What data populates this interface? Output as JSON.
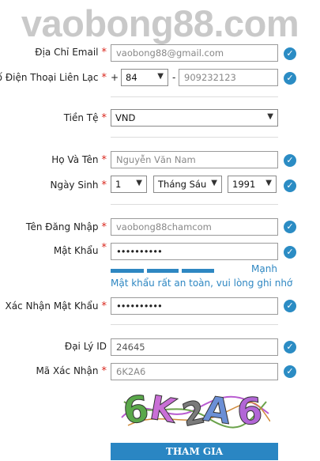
{
  "brand": {
    "watermark": "vaobong88.com"
  },
  "required_mark": "*",
  "fields": {
    "email": {
      "label": "Địa Chỉ Email",
      "placeholder": "vaobong88@gmail.com"
    },
    "phone": {
      "label": "Số Điện Thoại Liên Lạc",
      "prefix": "+",
      "code": "84",
      "dash": "-",
      "placeholder": "909232123"
    },
    "currency": {
      "label": "Tiền Tệ",
      "value": "VND"
    },
    "fullname": {
      "label": "Họ Và Tên",
      "placeholder": "Nguyễn Văn Nam"
    },
    "birthday": {
      "label": "Ngày Sinh",
      "day": "1",
      "month": "Tháng Sáu",
      "year": "1991"
    },
    "username": {
      "label": "Tên Đăng Nhập",
      "placeholder": "vaobong88chamcom"
    },
    "password": {
      "label": "Mật Khẩu",
      "value": "••••••••••",
      "strength_label": "Mạnh",
      "strength_level": 0.75,
      "hint": "Mật khẩu rất an toàn, vui lòng ghi nhớ"
    },
    "confirm_password": {
      "label": "Xác Nhận Mật Khẩu",
      "value": "••••••••••"
    },
    "agent_id": {
      "label": "Đại Lý ID",
      "value": "24645"
    },
    "captcha": {
      "label": "Mã Xác Nhận",
      "placeholder": "6K2A6",
      "image_text": "6K2A6"
    }
  },
  "submit": {
    "label": "THAM GIA"
  },
  "colors": {
    "accent": "#2a86c3",
    "required": "#d9261c",
    "check": "#2b8cc4"
  },
  "icons": {
    "valid": "check-circle-icon",
    "dropdown": "caret-down-icon"
  }
}
